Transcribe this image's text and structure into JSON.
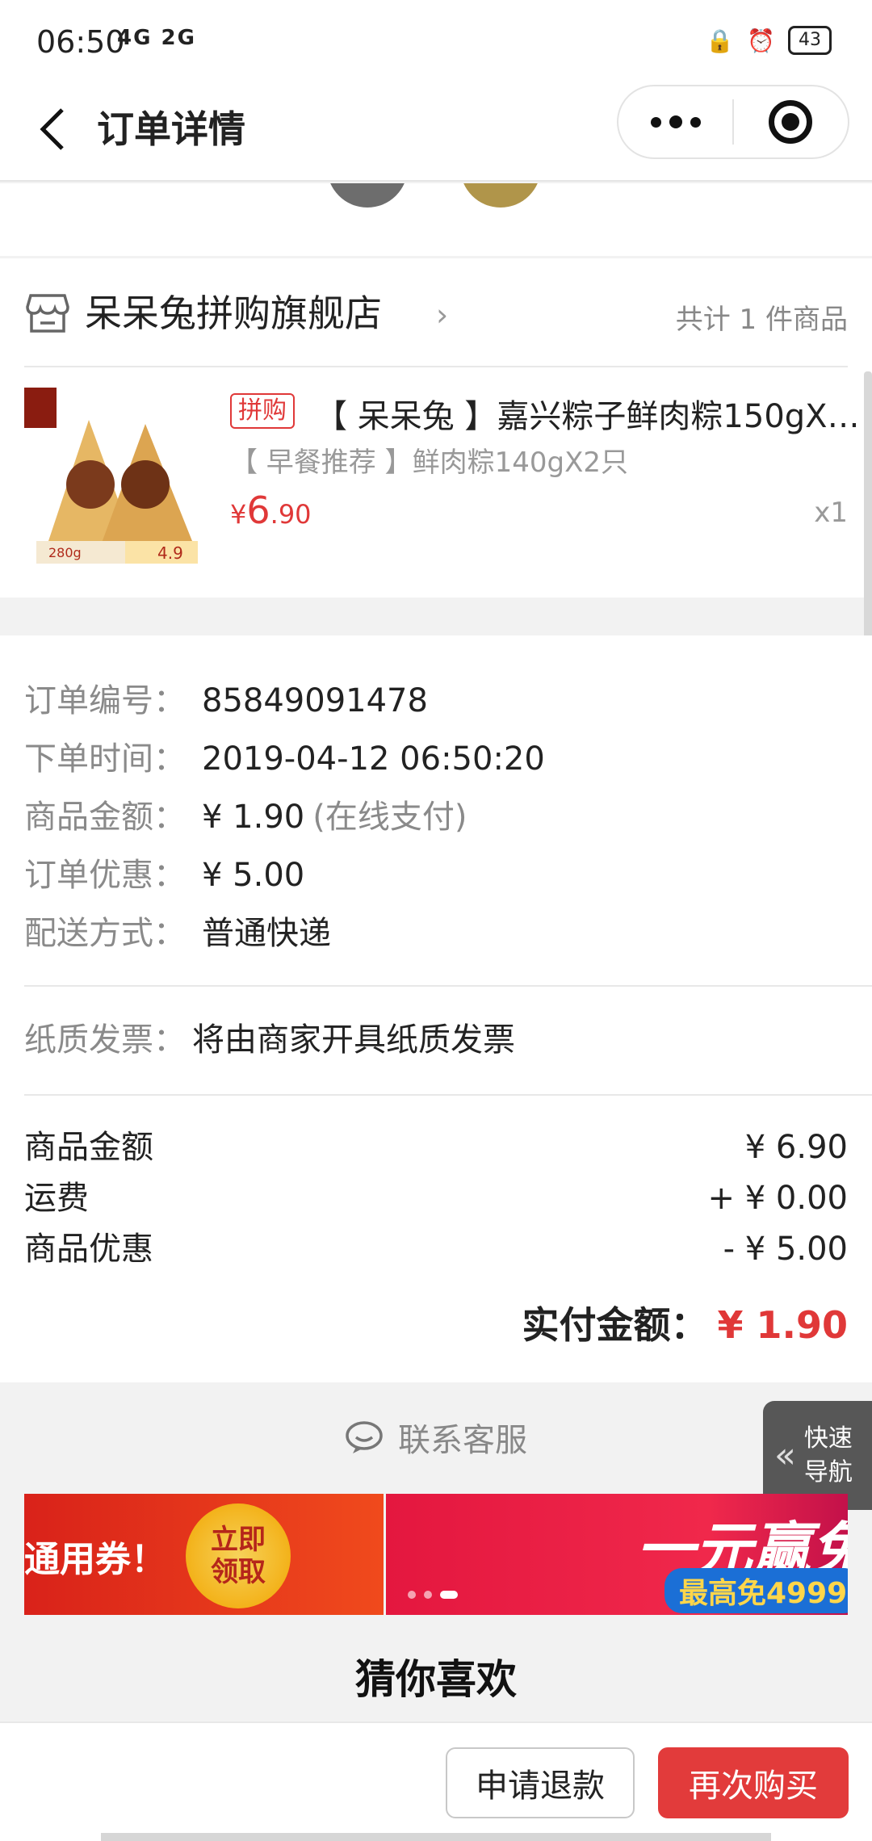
{
  "status_bar": {
    "time": "06:50",
    "signal": "4G 2G",
    "battery": "43"
  },
  "nav": {
    "title": "订单详情"
  },
  "store": {
    "name": "呆呆兔拼购旗舰店",
    "count_text": "共计 1 件商品"
  },
  "product": {
    "tag": "拼购",
    "title": "【 呆呆兔 】嘉兴粽子鲜肉粽150gX…",
    "spec": "【 早餐推荐 】鲜肉粽140gX2只",
    "price_yen": "¥",
    "price_int": "6",
    "price_dec": ".90",
    "qty": "x1"
  },
  "order_info": [
    {
      "key": "订单编号：",
      "value": "85849091478",
      "sub": ""
    },
    {
      "key": "下单时间：",
      "value": "2019-04-12 06:50:20",
      "sub": ""
    },
    {
      "key": "商品金额：",
      "value": "¥ 1.90",
      "sub": "(在线支付)"
    },
    {
      "key": "订单优惠：",
      "value": "¥ 5.00",
      "sub": ""
    },
    {
      "key": "配送方式：",
      "value": "普通快递",
      "sub": ""
    }
  ],
  "invoice": {
    "key": "纸质发票：",
    "value": "将由商家开具纸质发票"
  },
  "totals": [
    {
      "label": "商品金额",
      "value": "¥ 6.90"
    },
    {
      "label": "运费",
      "value": "+ ¥ 0.00"
    },
    {
      "label": "商品优惠",
      "value": "- ¥ 5.00"
    }
  ],
  "paid": {
    "label": "实付金额：",
    "amount": "¥ 1.90"
  },
  "service": {
    "label": "联系客服"
  },
  "quick_nav": {
    "line1": "快速",
    "line2": "导航"
  },
  "banners": {
    "left_text": "通用券！",
    "left_coin_1": "立即",
    "left_coin_2": "领取",
    "right_big": "一元赢免",
    "right_chip": "最高免4999"
  },
  "guess": {
    "title": "猜你喜欢"
  },
  "actions": {
    "refund": "申请退款",
    "rebuy": "再次购买"
  },
  "colors": {
    "accent_red": "#e23b3b",
    "price_red": "#e03838"
  }
}
